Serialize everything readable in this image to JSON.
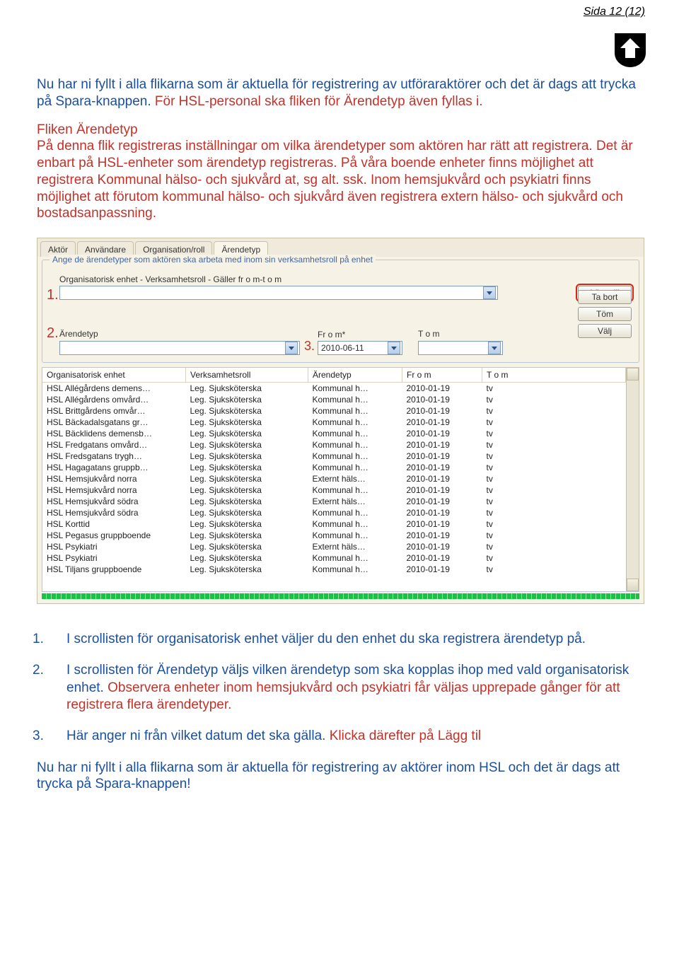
{
  "pagenum": "Sida 12 (12)",
  "intro_blue": "Nu har ni fyllt i alla flikarna som är aktuella för registrering av utföraraktörer och det är dags att trycka på Spara-knappen.",
  "intro_red": " För HSL-personal ska fliken för Ärendetyp även fyllas i.",
  "fliken_heading": "Fliken Ärendetyp",
  "fliken_body": "På denna flik registreras inställningar om vilka ärendetyper som aktören har rätt att registrera. Det är enbart på HSL-enheter som ärendetyp registreras. På våra boende enheter finns möjlighet att registrera Kommunal hälso- och sjukvård at, sg alt. ssk. Inom hemsjukvård och psykiatri finns möjlighet att förutom kommunal hälso- och sjukvård även registrera extern hälso- och sjukvård och bostadsanpassning.",
  "tabs": {
    "aktor": "Aktör",
    "anvandare": "Användare",
    "orgroll": "Organisation/roll",
    "arendetyp": "Ärendetyp"
  },
  "group_legend": "Ange de ärendetyper som aktören ska arbeta med inom sin verksamhetsroll på enhet",
  "labels": {
    "org": "Organisatorisk enhet - Verksamhetsroll - Gäller  fr o m-t o m",
    "arendetyp": "Ärendetyp",
    "from": "Fr o m*",
    "tom": "T o m"
  },
  "date_value": "2010-06-11",
  "buttons": {
    "lagg": "Lägg till",
    "tabort": "Ta bort",
    "tom": "Töm",
    "valj": "Välj"
  },
  "markers": {
    "m1": "1.",
    "m2": "2.",
    "m3": "3."
  },
  "columns": {
    "org": "Organisatorisk enhet",
    "roll": "Verksamhetsroll",
    "arende": "Ärendetyp",
    "from": "Fr o m",
    "tom": "T o m"
  },
  "rows": [
    {
      "org": "HSL Allégårdens demens…",
      "roll": "Leg. Sjuksköterska",
      "arende": "Kommunal h…",
      "from": "2010-01-19",
      "tom": "tv"
    },
    {
      "org": "HSL Allégårdens omvård…",
      "roll": "Leg. Sjuksköterska",
      "arende": "Kommunal h…",
      "from": "2010-01-19",
      "tom": "tv"
    },
    {
      "org": "HSL Brittgårdens omvår…",
      "roll": "Leg. Sjuksköterska",
      "arende": "Kommunal h…",
      "from": "2010-01-19",
      "tom": "tv"
    },
    {
      "org": "HSL Bäckadalsgatans gr…",
      "roll": "Leg. Sjuksköterska",
      "arende": "Kommunal h…",
      "from": "2010-01-19",
      "tom": "tv"
    },
    {
      "org": "HSL Bäcklidens demensb…",
      "roll": "Leg. Sjuksköterska",
      "arende": "Kommunal h…",
      "from": "2010-01-19",
      "tom": "tv"
    },
    {
      "org": "HSL Fredgatans omvård…",
      "roll": "Leg. Sjuksköterska",
      "arende": "Kommunal h…",
      "from": "2010-01-19",
      "tom": "tv"
    },
    {
      "org": "HSL Fredsgatans trygh…",
      "roll": "Leg. Sjuksköterska",
      "arende": "Kommunal h…",
      "from": "2010-01-19",
      "tom": "tv"
    },
    {
      "org": "HSL Hagagatans gruppb…",
      "roll": "Leg. Sjuksköterska",
      "arende": "Kommunal h…",
      "from": "2010-01-19",
      "tom": "tv"
    },
    {
      "org": "HSL Hemsjukvård norra",
      "roll": "Leg. Sjuksköterska",
      "arende": "Externt häls…",
      "from": "2010-01-19",
      "tom": "tv"
    },
    {
      "org": "HSL Hemsjukvård norra",
      "roll": "Leg. Sjuksköterska",
      "arende": "Kommunal h…",
      "from": "2010-01-19",
      "tom": "tv"
    },
    {
      "org": "HSL Hemsjukvård södra",
      "roll": "Leg. Sjuksköterska",
      "arende": "Externt häls…",
      "from": "2010-01-19",
      "tom": "tv"
    },
    {
      "org": "HSL Hemsjukvård södra",
      "roll": "Leg. Sjuksköterska",
      "arende": "Kommunal h…",
      "from": "2010-01-19",
      "tom": "tv"
    },
    {
      "org": "HSL Korttid",
      "roll": "Leg. Sjuksköterska",
      "arende": "Kommunal h…",
      "from": "2010-01-19",
      "tom": "tv"
    },
    {
      "org": "HSL Pegasus gruppboende",
      "roll": "Leg. Sjuksköterska",
      "arende": "Kommunal h…",
      "from": "2010-01-19",
      "tom": "tv"
    },
    {
      "org": "HSL Psykiatri",
      "roll": "Leg. Sjuksköterska",
      "arende": "Externt häls…",
      "from": "2010-01-19",
      "tom": "tv"
    },
    {
      "org": "HSL Psykiatri",
      "roll": "Leg. Sjuksköterska",
      "arende": "Kommunal h…",
      "from": "2010-01-19",
      "tom": "tv"
    },
    {
      "org": "HSL Tiljans gruppboende",
      "roll": "Leg. Sjuksköterska",
      "arende": "Kommunal h…",
      "from": "2010-01-19",
      "tom": "tv"
    }
  ],
  "num": {
    "n1": "1.",
    "t1": "I scrollisten för organisatorisk enhet väljer du den enhet du ska registrera ärendetyp på.",
    "n2": "2.",
    "t2a": "I scrollisten för Ärendetyp väljs vilken ärendetyp som ska kopplas ihop med vald organisatorisk enhet.",
    "t2b": " Observera enheter inom hemsjukvård och psykiatri får väljas upprepade gånger för att registrera flera ärendetyper.",
    "n3": "3.",
    "t3a": "Här anger ni från vilket datum det ska gälla.",
    "t3b": " Klicka därefter på Lägg til"
  },
  "final": "Nu har ni fyllt i alla flikarna som är aktuella för registrering av aktörer inom HSL och det är dags att trycka på Spara-knappen!"
}
